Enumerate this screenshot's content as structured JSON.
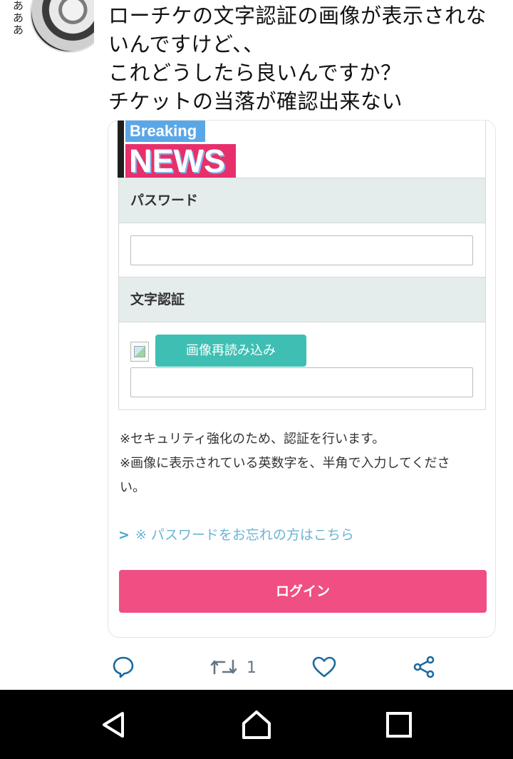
{
  "tweet": {
    "avatar_scribble": "あ\nあ\nあ",
    "lines": [
      "ローチケの文字認証の画像が表示されな",
      "いんですけど、、",
      "これどうしたら良いんですか？",
      "チケットの当落が確認出来ない"
    ]
  },
  "embed": {
    "logo": {
      "breaking": "Breaking",
      "news": "NEWS"
    },
    "password_label": "パスワード",
    "password_value": "",
    "captcha_label": "文字認証",
    "reload_button": "画像再読み込み",
    "captcha_value": "",
    "notes": [
      "※セキュリティ強化のため、認証を行います。",
      "※画像に表示されている英数字を、半角で入力してくださ",
      "い。"
    ],
    "forgot_link": "※ パスワードをお忘れの方はこちら",
    "login_button": "ログイン"
  },
  "actions": {
    "reply_icon": "reply-icon",
    "retweet_icon": "retweet-icon",
    "retweet_count": "1",
    "like_icon": "heart-icon",
    "share_icon": "share-icon"
  },
  "colors": {
    "reload_button": "#3fbfb3",
    "login_button": "#ef4f82",
    "link": "#6bb4d4",
    "breaking_bg": "#5aa7e8",
    "news_bg": "#e7306b",
    "section_bg": "#e5ecec"
  }
}
